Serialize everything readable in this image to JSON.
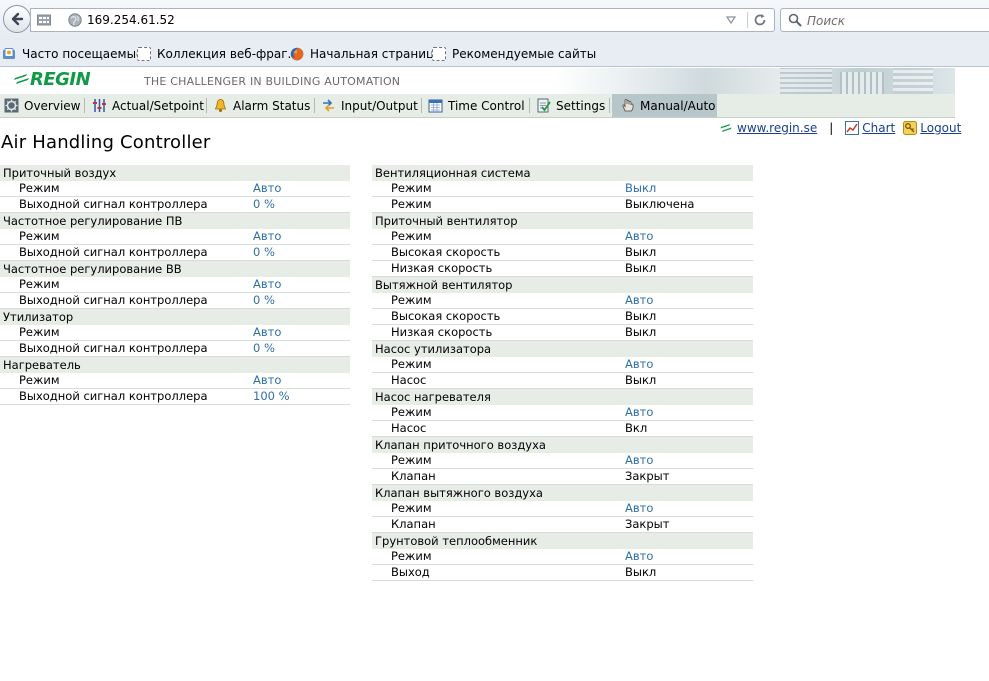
{
  "browser": {
    "url": "169.254.61.52",
    "search_placeholder": "Поиск"
  },
  "bookmarks": [
    {
      "label": "Часто посещаемые"
    },
    {
      "label": "Коллекция веб-фраг..."
    },
    {
      "label": "Начальная страница"
    },
    {
      "label": "Рекомендуемые сайты"
    }
  ],
  "header": {
    "logo": "REGIN",
    "tagline": "THE CHALLENGER IN BUILDING AUTOMATION"
  },
  "tabs": [
    {
      "label": "Overview",
      "icon": "gear-icon"
    },
    {
      "label": "Actual/Setpoint",
      "icon": "sliders-icon"
    },
    {
      "label": "Alarm Status",
      "icon": "bell-icon"
    },
    {
      "label": "Input/Output",
      "icon": "arrows-icon"
    },
    {
      "label": "Time Control",
      "icon": "calendar-icon"
    },
    {
      "label": "Settings",
      "icon": "checklist-icon"
    },
    {
      "label": "Manual/Auto",
      "icon": "hand-icon"
    }
  ],
  "active_tab": "Manual/Auto",
  "page": {
    "title": "Air Handling Controller",
    "links": {
      "site": "www.regin.se",
      "separator": "|",
      "chart": "Chart",
      "logout": "Logout"
    }
  },
  "left_groups": [
    {
      "title": "Приточный воздух",
      "rows": [
        {
          "label": "Режим",
          "value": "Авто",
          "link": true
        },
        {
          "label": "Выходной сигнал контроллера",
          "value": "0 %",
          "link": true
        }
      ]
    },
    {
      "title": "Частотное регулирование ПВ",
      "rows": [
        {
          "label": "Режим",
          "value": "Авто",
          "link": true
        },
        {
          "label": "Выходной сигнал контроллера",
          "value": "0 %",
          "link": true
        }
      ]
    },
    {
      "title": "Частотное регулирование ВВ",
      "rows": [
        {
          "label": "Режим",
          "value": "Авто",
          "link": true
        },
        {
          "label": "Выходной сигнал контроллера",
          "value": "0 %",
          "link": true
        }
      ]
    },
    {
      "title": "Утилизатор",
      "rows": [
        {
          "label": "Режим",
          "value": "Авто",
          "link": true
        },
        {
          "label": "Выходной сигнал контроллера",
          "value": "0 %",
          "link": true
        }
      ]
    },
    {
      "title": "Нагреватель",
      "rows": [
        {
          "label": "Режим",
          "value": "Авто",
          "link": true
        },
        {
          "label": "Выходной сигнал контроллера",
          "value": "100 %",
          "link": true
        }
      ]
    }
  ],
  "right_groups": [
    {
      "title": "Вентиляционная система",
      "rows": [
        {
          "label": "Режим",
          "value": "Выкл",
          "link": true
        },
        {
          "label": "Режим",
          "value": "Выключена",
          "link": false
        }
      ]
    },
    {
      "title": "Приточный вентилятор",
      "rows": [
        {
          "label": "Режим",
          "value": "Авто",
          "link": true
        },
        {
          "label": "Высокая скорость",
          "value": "Выкл",
          "link": false
        },
        {
          "label": "Низкая скорость",
          "value": "Выкл",
          "link": false
        }
      ]
    },
    {
      "title": "Вытяжной вентилятор",
      "rows": [
        {
          "label": "Режим",
          "value": "Авто",
          "link": true
        },
        {
          "label": "Высокая скорость",
          "value": "Выкл",
          "link": false
        },
        {
          "label": "Низкая скорость",
          "value": "Выкл",
          "link": false
        }
      ]
    },
    {
      "title": "Насос утилизатора",
      "rows": [
        {
          "label": "Режим",
          "value": "Авто",
          "link": true
        },
        {
          "label": "Насос",
          "value": "Выкл",
          "link": false
        }
      ]
    },
    {
      "title": "Насос нагревателя",
      "rows": [
        {
          "label": "Режим",
          "value": "Авто",
          "link": true
        },
        {
          "label": "Насос",
          "value": "Вкл",
          "link": false
        }
      ]
    },
    {
      "title": "Клапан приточного воздуха",
      "rows": [
        {
          "label": "Режим",
          "value": "Авто",
          "link": true
        },
        {
          "label": "Клапан",
          "value": "Закрыт",
          "link": false
        }
      ]
    },
    {
      "title": "Клапан вытяжного воздуха",
      "rows": [
        {
          "label": "Режим",
          "value": "Авто",
          "link": true
        },
        {
          "label": "Клапан",
          "value": "Закрыт",
          "link": false
        }
      ]
    },
    {
      "title": "Грунтовой теплообменник",
      "rows": [
        {
          "label": "Режим",
          "value": "Авто",
          "link": true
        },
        {
          "label": "Выход",
          "value": "Выкл",
          "link": false
        }
      ]
    }
  ],
  "colors": {
    "brand_green": "#109a46",
    "link_blue": "#2f6ea8",
    "group_bg": "#e7ece7",
    "active_tab_bg": "#b7c6c8"
  }
}
